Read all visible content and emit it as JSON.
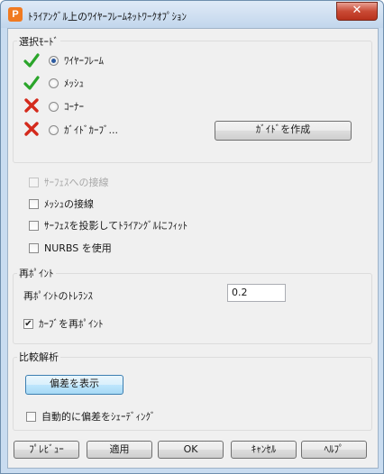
{
  "window": {
    "title": "ﾄﾗｲｱﾝｸﾞﾙ上のﾜｲﾔｰﾌﾚｰﾑﾈｯﾄﾜｰｸｵﾌﾟｼｮﾝ",
    "app_icon_letter": "P",
    "close_glyph": "✕"
  },
  "selection_mode": {
    "label": "選択ﾓｰﾄﾞ",
    "options": [
      {
        "label": "ﾜｲﾔｰﾌﾚｰﾑ",
        "selected": true,
        "status_icon": "check-icon"
      },
      {
        "label": "ﾒｯｼｭ",
        "selected": false,
        "status_icon": "check-icon"
      },
      {
        "label": "ｺｰﾅｰ",
        "selected": false,
        "status_icon": "cross-icon"
      },
      {
        "label": "ｶﾞｲﾄﾞｶｰﾌﾞ...",
        "selected": false,
        "status_icon": "cross-icon"
      }
    ],
    "create_guide_button": "ｶﾞｲﾄﾞを作成"
  },
  "options": {
    "surface_tangent": {
      "label": "ｻｰﾌｪｽへの接線",
      "checked": false,
      "disabled": true
    },
    "mesh_tangent": {
      "label": "ﾒｯｼｭの接線",
      "checked": false
    },
    "project_surface": {
      "label": "ｻｰﾌｪｽを投影してﾄﾗｲｱﾝｸﾞﾙにﾌｨｯﾄ",
      "checked": false
    },
    "use_nurbs": {
      "label": "NURBS を使用",
      "checked": false
    }
  },
  "repoint": {
    "label": "再ﾎﾟｲﾝﾄ",
    "tolerance_label": "再ﾎﾟｲﾝﾄのﾄﾚﾗﾝｽ",
    "tolerance_value": "0.2",
    "repoint_curve": {
      "label": "ｶｰﾌﾞを再ﾎﾟｲﾝﾄ",
      "checked": true
    }
  },
  "comparison": {
    "label": "比較解析",
    "show_deviation_button": "偏差を表示",
    "auto_shade": {
      "label": "自動的に偏差をｼｪｰﾃﾞｨﾝｸﾞ",
      "checked": false
    }
  },
  "footer": {
    "preview": "ﾌﾟﾚﾋﾞｭｰ",
    "apply": "適用",
    "ok": "OK",
    "cancel": "ｷｬﾝｾﾙ",
    "help": "ﾍﾙﾌﾟ"
  },
  "colors": {
    "check": "#2aa52a",
    "cross": "#d42a1c",
    "title_bar": "#c9dcf0"
  }
}
